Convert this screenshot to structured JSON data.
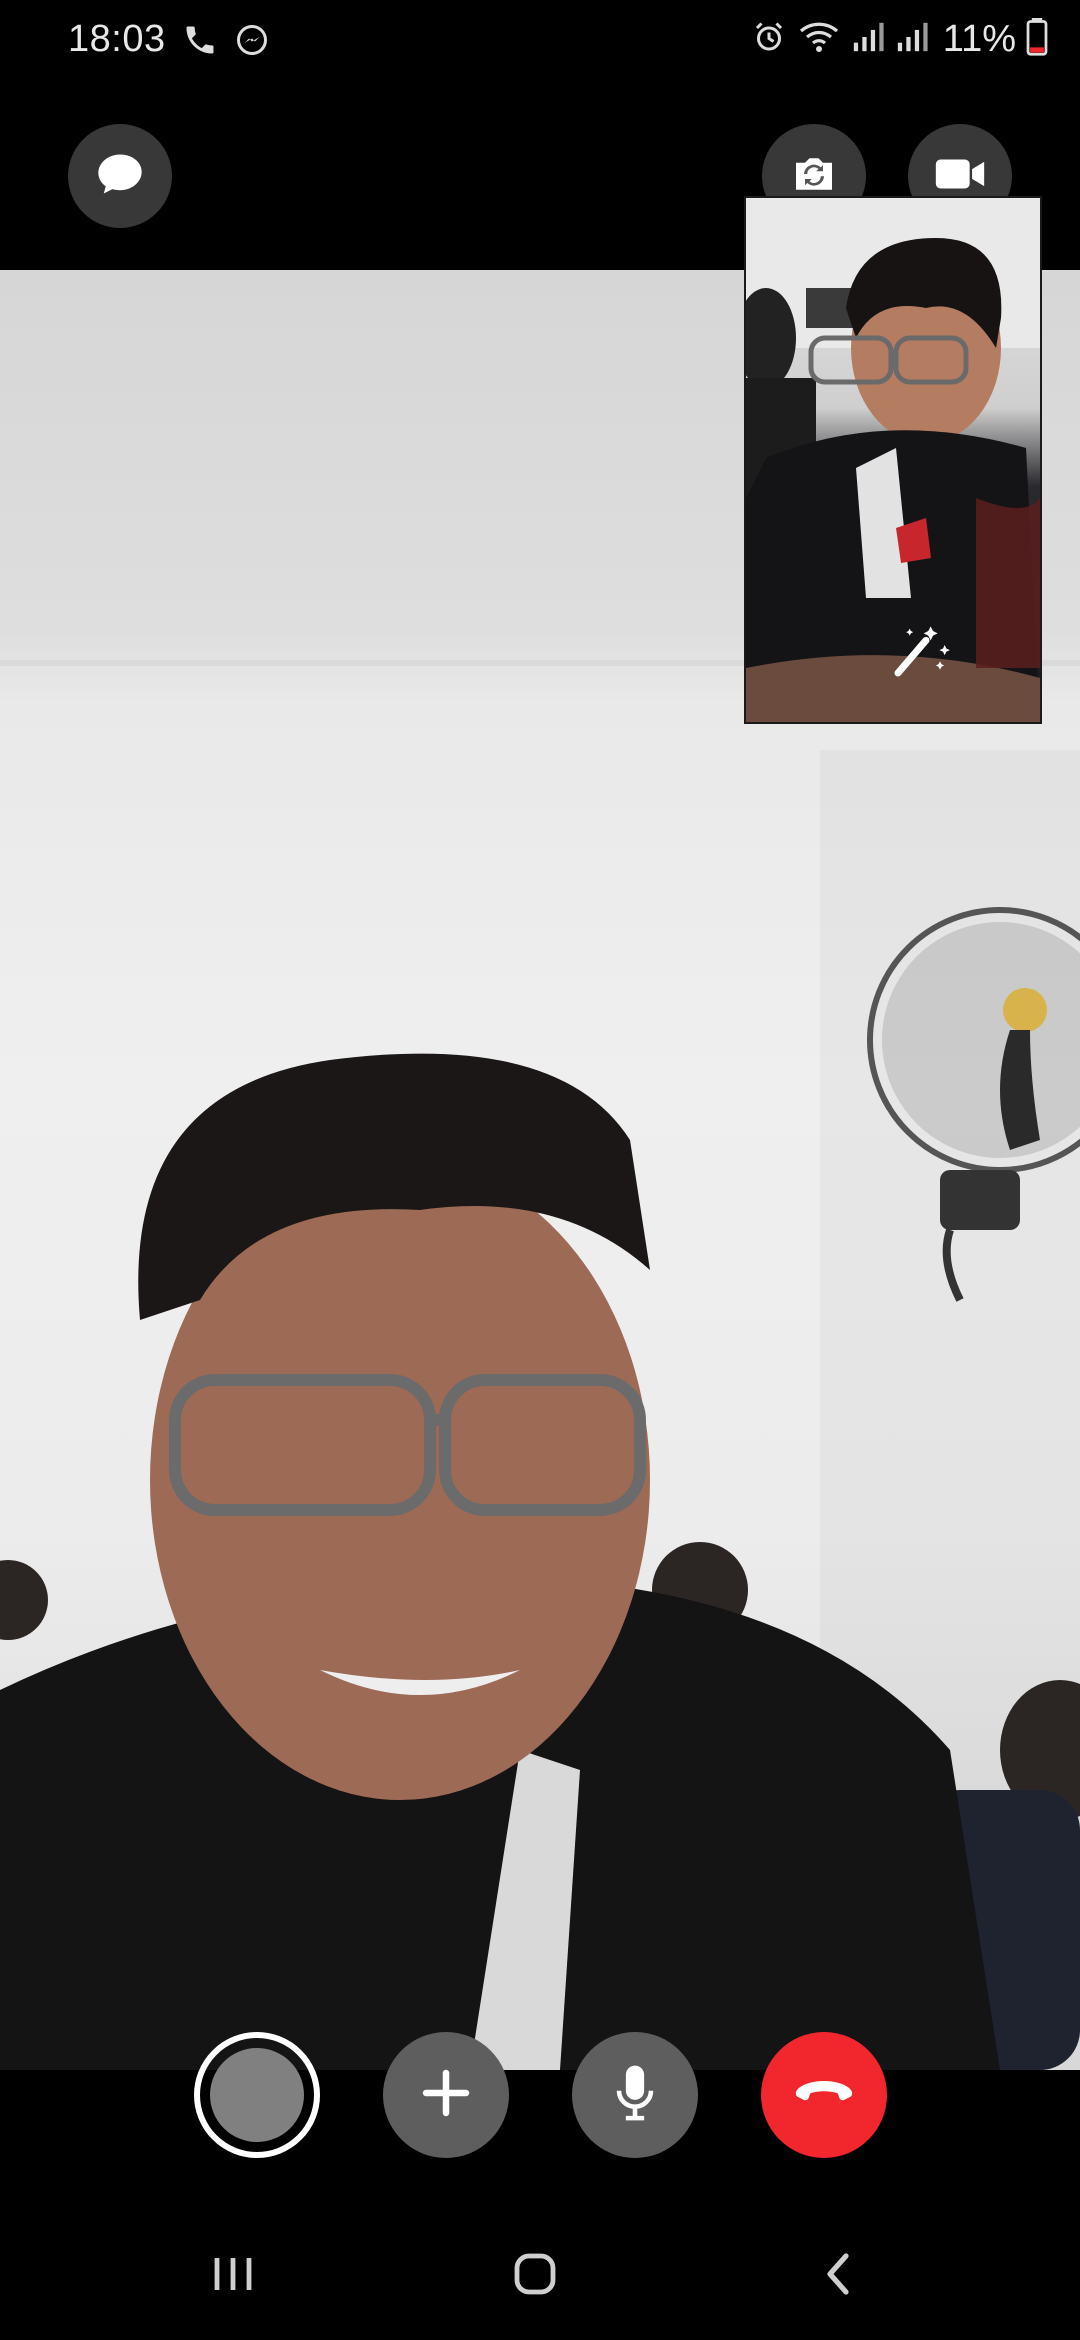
{
  "status_bar": {
    "time": "18:03",
    "battery_percent": "11%",
    "left_icons": [
      "phone-icon",
      "messenger-icon"
    ],
    "right_icons": [
      "alarm-icon",
      "wifi-icon",
      "signal-icon",
      "signal-icon",
      "battery-low-icon"
    ]
  },
  "top_controls": {
    "chat_icon": "chat-bubble-icon",
    "flip_camera_icon": "camera-flip-icon",
    "video_icon": "video-camera-icon"
  },
  "self_view": {
    "effects_icon": "magic-wand-icon"
  },
  "call_controls": {
    "capture_icon": "capture-shutter-icon",
    "add_icon": "plus-icon",
    "mic_icon": "microphone-icon",
    "end_icon": "end-call-icon",
    "end_color": "#f2262d"
  },
  "nav_bar": {
    "recent_icon": "recent-apps-icon",
    "home_icon": "home-icon",
    "back_icon": "back-icon"
  }
}
